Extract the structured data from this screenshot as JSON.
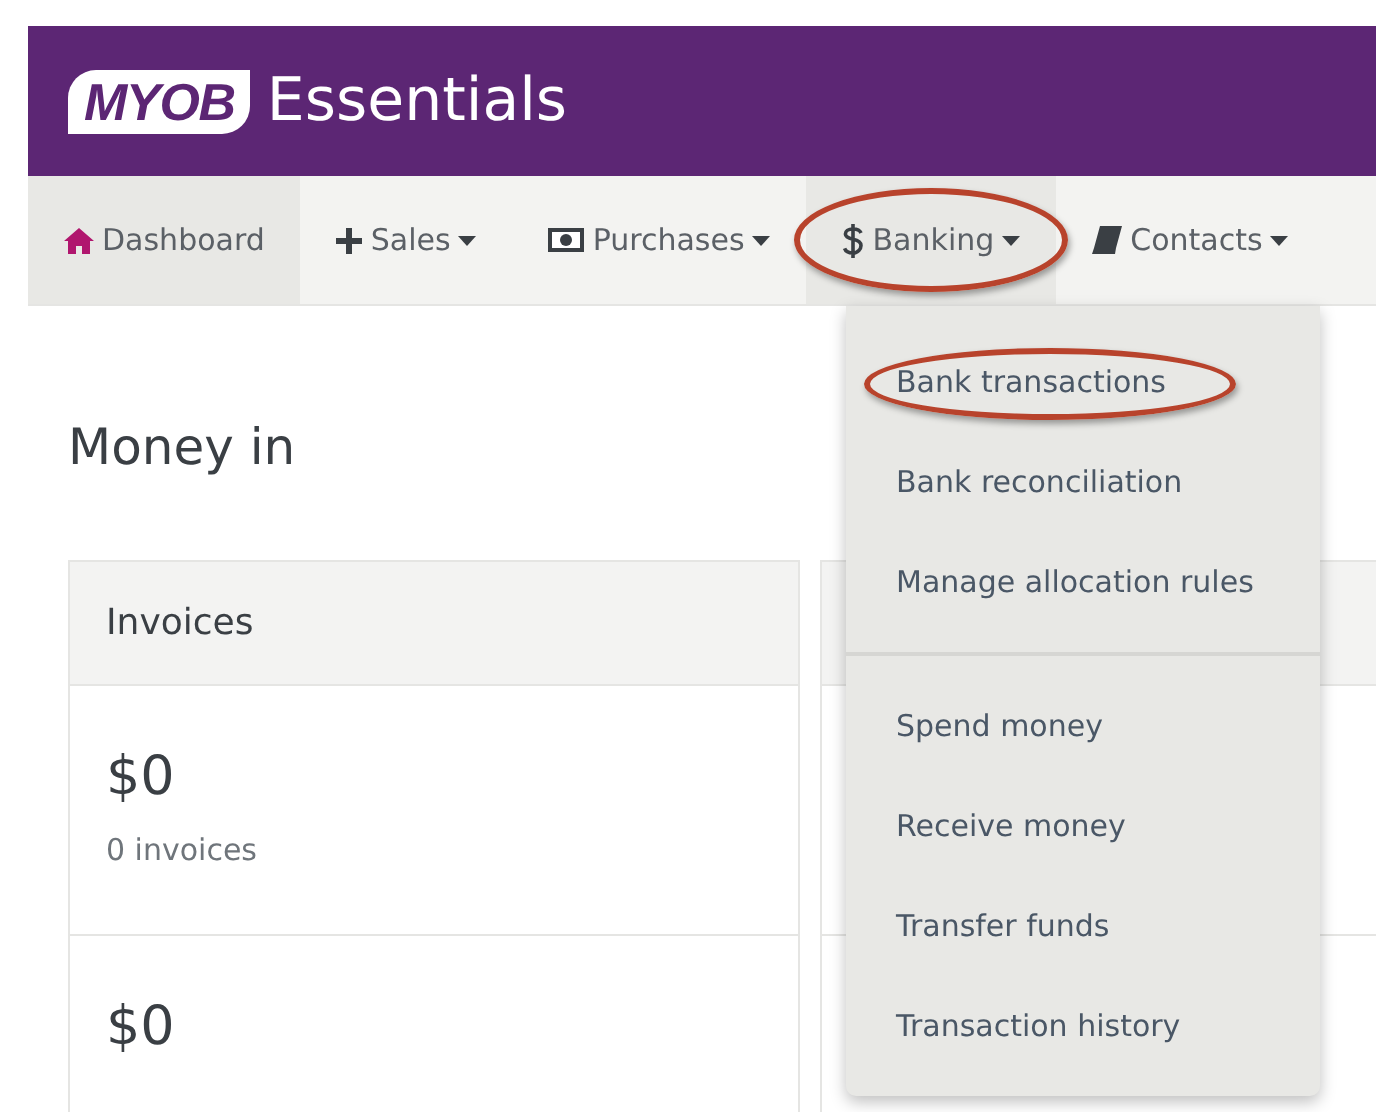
{
  "header": {
    "logo": "MYOB",
    "product": "Essentials"
  },
  "nav": [
    {
      "label": "Dashboard",
      "dropdown": false,
      "selected": true,
      "circled": false
    },
    {
      "label": "Sales",
      "dropdown": true,
      "selected": false,
      "circled": false
    },
    {
      "label": "Purchases",
      "dropdown": true,
      "selected": false,
      "circled": false
    },
    {
      "label": "Banking",
      "dropdown": true,
      "selected": true,
      "circled": true,
      "menu": {
        "groups": [
          [
            {
              "label": "Bank transactions",
              "circled": true
            },
            {
              "label": "Bank reconciliation",
              "circled": false
            },
            {
              "label": "Manage allocation rules",
              "circled": false
            }
          ],
          [
            {
              "label": "Spend money",
              "circled": false
            },
            {
              "label": "Receive money",
              "circled": false
            },
            {
              "label": "Transfer funds",
              "circled": false
            },
            {
              "label": "Transaction history",
              "circled": false
            }
          ]
        ]
      }
    },
    {
      "label": "Contacts",
      "dropdown": true,
      "selected": false,
      "circled": false
    }
  ],
  "section_title": "Money in",
  "card": {
    "title": "Invoices",
    "rows": [
      {
        "amount": "$0",
        "note": "0 invoices"
      },
      {
        "amount": "$0"
      }
    ]
  }
}
